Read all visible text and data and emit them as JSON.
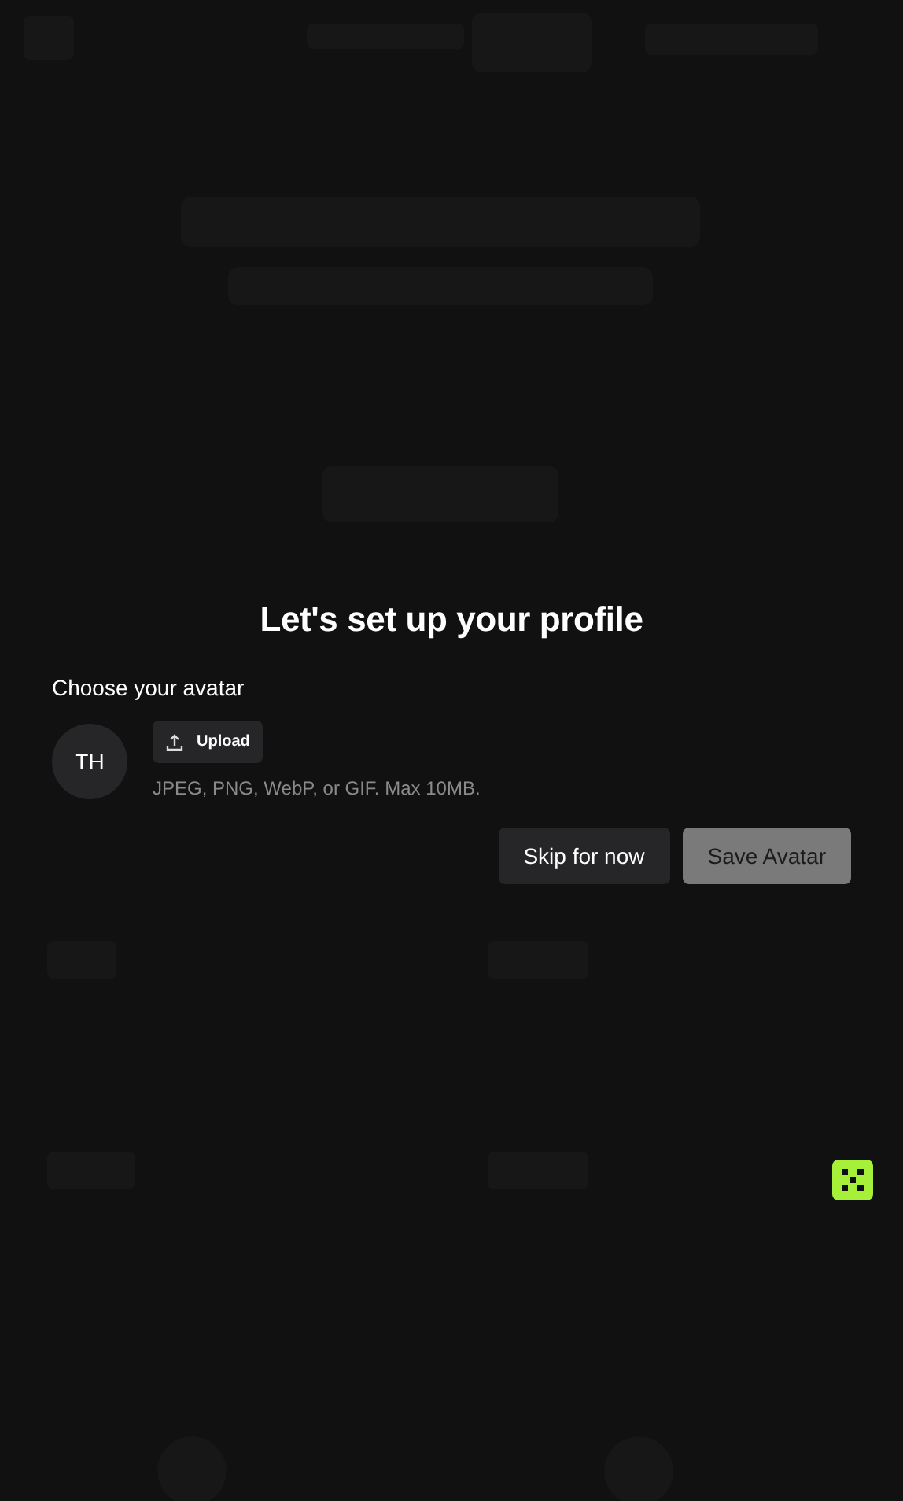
{
  "dialog": {
    "title": "Let's set up your profile",
    "section_label": "Choose your avatar",
    "avatar": {
      "initials": "TH"
    },
    "upload_button": {
      "label": "Upload"
    },
    "hint": "JPEG, PNG, WebP, or GIF. Max 10MB.",
    "buttons": [
      {
        "label": "Skip for now",
        "kind": "secondary",
        "disabled": false
      },
      {
        "label": "Save Avatar",
        "kind": "primary",
        "disabled": true
      }
    ]
  }
}
